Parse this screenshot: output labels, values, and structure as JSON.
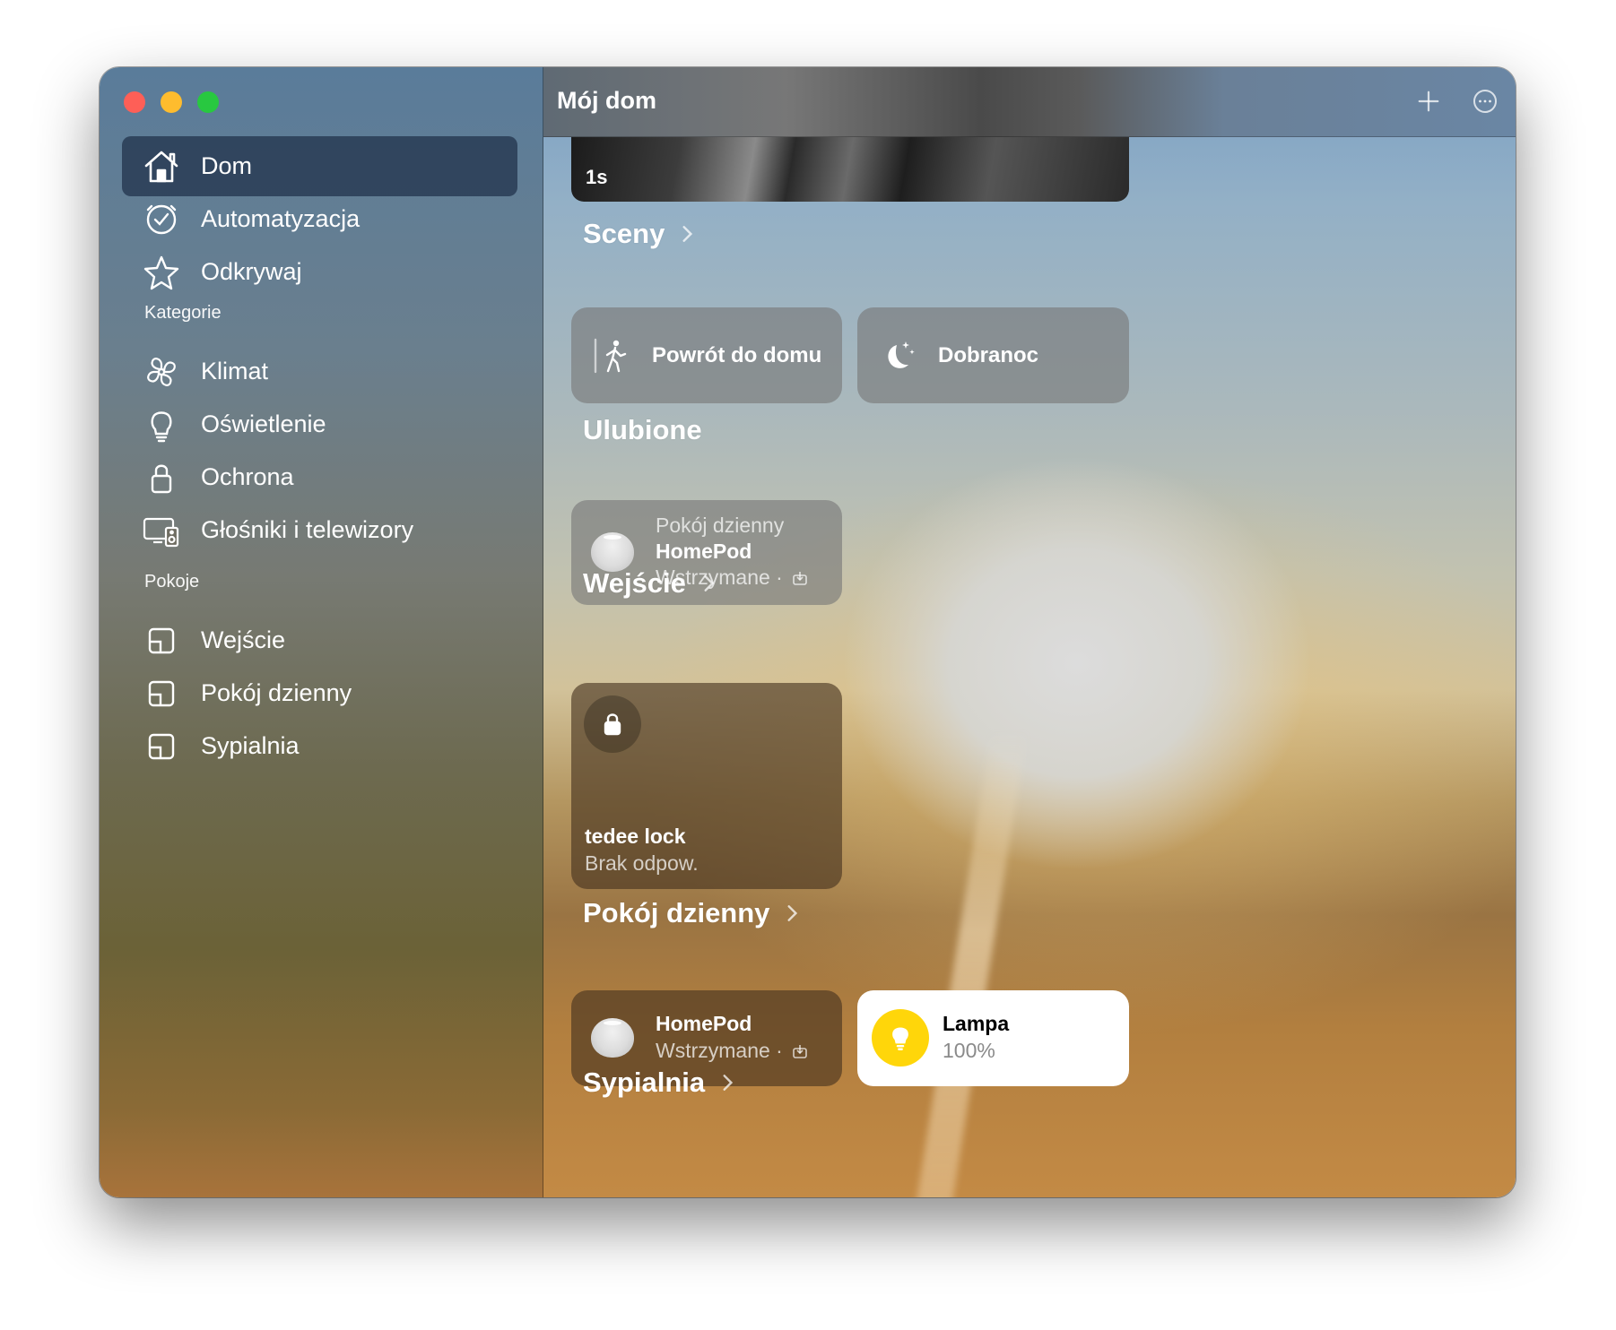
{
  "window": {
    "title": "Mój dom"
  },
  "toolbar": {
    "add_icon": "plus-icon",
    "more_icon": "ellipsis-circle-icon"
  },
  "sidebar": {
    "main_items": [
      {
        "label": "Dom",
        "icon": "house-icon",
        "selected": true
      },
      {
        "label": "Automatyzacja",
        "icon": "clock-check-icon",
        "selected": false
      },
      {
        "label": "Odkrywaj",
        "icon": "star-icon",
        "selected": false
      }
    ],
    "categories_label": "Kategorie",
    "categories": [
      {
        "label": "Klimat",
        "icon": "fan-icon"
      },
      {
        "label": "Oświetlenie",
        "icon": "lightbulb-icon"
      },
      {
        "label": "Ochrona",
        "icon": "lock-icon"
      },
      {
        "label": "Głośniki i telewizory",
        "icon": "tv-speaker-icon"
      }
    ],
    "rooms_label": "Pokoje",
    "rooms": [
      {
        "label": "Wejście",
        "icon": "room-icon"
      },
      {
        "label": "Pokój dzienny",
        "icon": "room-icon"
      },
      {
        "label": "Sypialnia",
        "icon": "room-icon"
      }
    ]
  },
  "camera": {
    "time": "1s"
  },
  "sections": {
    "scenes": {
      "title": "Sceny",
      "items": [
        {
          "label": "Powrót do domu",
          "icon": "person-arriving-icon"
        },
        {
          "label": "Dobranoc",
          "icon": "moon-stars-icon"
        }
      ]
    },
    "favorites": {
      "title": "Ulubione",
      "homepod": {
        "room": "Pokój dzienny",
        "name": "HomePod",
        "status": "Wstrzymane ·"
      }
    },
    "entrance": {
      "title": "Wejście",
      "lock": {
        "name": "tedee lock",
        "status": "Brak odpow."
      }
    },
    "living_room": {
      "title": "Pokój dzienny",
      "homepod": {
        "name": "HomePod",
        "status": "Wstrzymane ·"
      },
      "lamp": {
        "name": "Lampa",
        "level": "100%"
      }
    },
    "bedroom": {
      "title": "Sypialnia"
    }
  },
  "colors": {
    "sidebar_selected": "#24364e",
    "lamp_on": "#ffd60a",
    "close": "#fe5f57",
    "minimize": "#febc2e",
    "maximize": "#28c840"
  }
}
